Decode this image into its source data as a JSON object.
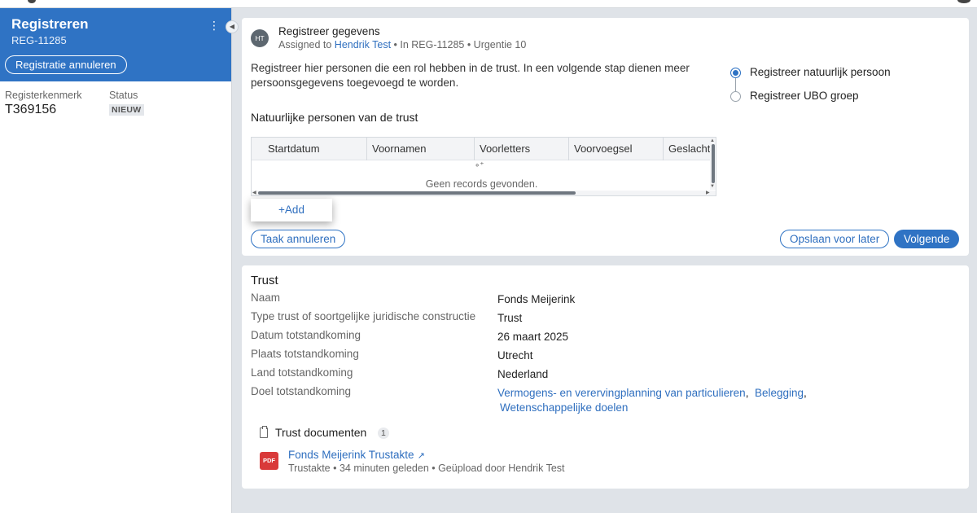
{
  "sidebar": {
    "title": "Registreren",
    "reference": "REG-11285",
    "cancel_label": "Registratie annuleren",
    "menu_icon": "⋮",
    "collapse_icon": "◀",
    "register_label": "Registerkenmerk",
    "register_value": "T369156",
    "status_label": "Status",
    "status_value": "NIEUW"
  },
  "task": {
    "avatar_initials": "HT",
    "title": "Registreer gegevens",
    "assigned_prefix": "Assigned to ",
    "assignee": "Hendrik Test",
    "meta_suffix": " • In REG-11285 • Urgentie 10",
    "description": "Registreer hier personen die een rol hebben in de trust. In een volgende stap dienen meer persoonsgegevens toegevoegd te worden.",
    "steps": [
      {
        "label": "Registreer natuurlijk persoon",
        "active": true
      },
      {
        "label": "Registreer UBO groep",
        "active": false
      }
    ],
    "section_title": "Natuurlijke personen van de trust",
    "table": {
      "columns": [
        "Startdatum",
        "Voornamen",
        "Voorletters",
        "Voorvoegsel",
        "Geslachtsnaam"
      ],
      "empty_message": "Geen records gevonden."
    },
    "add_label": "+Add",
    "cancel_label": "Taak annuleren",
    "save_later_label": "Opslaan voor later",
    "next_label": "Volgende"
  },
  "trust": {
    "title": "Trust",
    "fields": [
      {
        "label": "Naam",
        "value": "Fonds Meijerink"
      },
      {
        "label": "Type trust of soortgelijke juridische constructie",
        "value": "Trust"
      },
      {
        "label": "Datum totstandkoming",
        "value": "26 maart 2025"
      },
      {
        "label": "Plaats totstandkoming",
        "value": "Utrecht"
      },
      {
        "label": "Land totstandkoming",
        "value": "Nederland"
      }
    ],
    "purpose_label": "Doel totstandkoming",
    "purposes": [
      "Vermogens- en vererving­planning van particulieren",
      "Belegging",
      "Wetenschappelijke doelen"
    ],
    "documents_title": "Trust documenten",
    "documents_count": "1",
    "document": {
      "type_icon": "PDF",
      "name": "Fonds Meijerink Trustakte",
      "meta": "Trustakte • 34 minuten geleden • Geüpload door Hendrik Test"
    }
  }
}
